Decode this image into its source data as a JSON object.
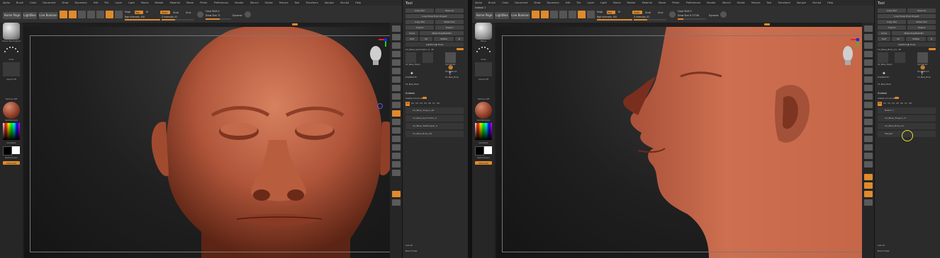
{
  "colors": {
    "accent": "#e08a2c",
    "skin": "#b55a3d",
    "panel": "#2b2b2b"
  },
  "panels": [
    {
      "menu": [
        "Alpha",
        "Brush",
        "Color",
        "Document",
        "Draw",
        "Dynamics",
        "Edit",
        "File",
        "Layer",
        "Light",
        "Macro",
        "Marker",
        "Material",
        "Movie",
        "Picker",
        "Preferences",
        "Render",
        "Stencil",
        "Stroke",
        "Texture",
        "Tool",
        "Transform",
        "Zplugin",
        "Zscript",
        "Help"
      ],
      "topbar": {
        "home_page": "Home Page",
        "lightbox": "LightBox",
        "live_boolean": "Live Boolean",
        "mrgb": "Mrgb",
        "rgb": "Rgb",
        "m_btn": "M",
        "zadd": "Zadd",
        "zsub": "Zsub",
        "zcut": "Zcut",
        "focal_shift": "Focal Shift 0",
        "draw_size": "Draw Size 71",
        "dynamic": "Dynamic",
        "rgb_intensity": "Rgb Intensity 100",
        "z_intensity": "Z Intensity 41"
      },
      "left": {
        "brush_label": "Move Topological",
        "stroke_label": "Dots",
        "alpha_label": "Alpha Off",
        "texture_label": "Texture Off",
        "material_label": "SkinShade4",
        "gradient_label": "Gradient",
        "switch_color": "SwitchColor",
        "alternate": "Alternate"
      },
      "tray": {
        "title": "Tool",
        "load_tool": "Load Tool",
        "save_as": "Save As",
        "load_from_project": "Load Tools From Project",
        "copy_tool": "Copy Tool",
        "paste_tool": "Paste Tool",
        "import": "Import",
        "export": "Export",
        "clone": "Clone",
        "make_polymesh": "Make PolyMesh3D",
        "goz": "GoZ",
        "all": "All",
        "visible": "Visible",
        "r_btn": "R",
        "lightbox_tools": "Lightbox ▶ Tools",
        "current_tool": "C2_Base_Symmetric_0. 48",
        "tools": [
          "C2_Base_Sharpr",
          "Cylinder3D",
          "SimpleBrush",
          "PolyMesh3D",
          "C2_Base_Body",
          "C2_Base_Basic"
        ],
        "subtool_title": "Subtool",
        "visible_count": "Visible Count 1k",
        "layer_nums": [
          "V1",
          "V2",
          "V3",
          "V4",
          "V5",
          "V6",
          "V7",
          "V8"
        ],
        "subtools": [
          "C2_Base_Tongue_46",
          "C2_Base_Symmetric_0",
          "C2_Base_TeethUpper_0",
          "C2_Base_Body_06"
        ],
        "list_all": "List All",
        "new_folder": "New Folder"
      }
    },
    {
      "menu": [
        "Alpha",
        "Brush",
        "Color",
        "Document",
        "Draw",
        "Dynamics",
        "Edit",
        "File",
        "Layer",
        "Light",
        "Macro",
        "Marker",
        "Material",
        "Movie",
        "Picker",
        "Preferences",
        "Render",
        "Stencil",
        "Stroke",
        "Texture",
        "Tool",
        "Transform",
        "Zplugin",
        "Zscript",
        "Help"
      ],
      "subtool_header": "Subtool 1",
      "topbar": {
        "home_page": "Home Page",
        "lightbox": "LightBox",
        "live_boolean": "Live Boolean",
        "mrgb": "Mrgb",
        "rgb": "Rgb",
        "m_btn": "M",
        "zadd": "Zadd",
        "zsub": "Zsub",
        "zcut": "Zcut",
        "focal_shift": "Focal Shift 0",
        "draw_size": "Draw Size 9.72748",
        "dynamic": "Dynamic",
        "rgb_intensity": "Rgb Intensity 100",
        "z_intensity": "Z Intensity 41"
      },
      "left": {
        "brush_label": "Move",
        "stroke_label": "Dots",
        "alpha_label": "Alpha Off",
        "texture_label": "Texture Off",
        "material_label": "SkinShade4",
        "gradient_label": "Gradient",
        "switch_color": "SwitchColor",
        "alternate": "Alternate"
      },
      "tray": {
        "title": "Tool",
        "load_tool": "Load Tool",
        "save_as": "Save As",
        "load_from_project": "Load Tools From Project",
        "copy_tool": "Copy Tool",
        "paste_tool": "Paste Tool",
        "import": "Import",
        "export": "Export",
        "clone": "Clone",
        "make_polymesh": "Make PolyMesh3D",
        "goz": "GoZ",
        "all": "All",
        "visible": "Visible",
        "r_btn": "R",
        "lightbox_tools": "Lightbox ▶ Tools",
        "current_tool": "C2_Base_Body_01. 48",
        "tools": [
          "C2_Base_Sharpr",
          "Cylinder3D",
          "SimpleBrush",
          "PolyMesh3D",
          "C2_Base_Body",
          "C2_Base_Basic"
        ],
        "subtool_title": "Subtool",
        "visible_count": "Visible Count 1k",
        "layer_nums": [
          "V1",
          "V2",
          "V3",
          "V4",
          "V5",
          "V6",
          "V7",
          "V8"
        ],
        "subtools": [
          "Button 1",
          "C2_Base_Tongue_17",
          "C2_Base_Body_01",
          "Merged"
        ],
        "list_all": "List All",
        "new_folder": "New Folder"
      }
    }
  ]
}
